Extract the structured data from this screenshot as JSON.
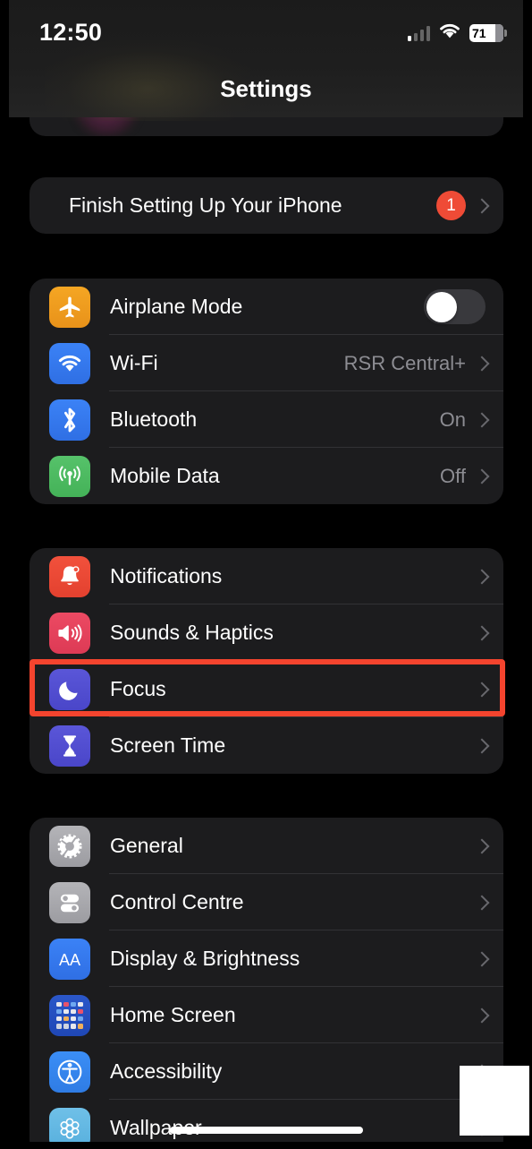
{
  "status_bar": {
    "time": "12:50",
    "signal_icon": "cellular-signal-icon",
    "wifi_icon": "wifi-icon",
    "battery_level": "71",
    "battery_icon": "battery-icon"
  },
  "nav": {
    "title": "Settings"
  },
  "colors": {
    "background": "#000000",
    "card": "#1c1c1e",
    "separator": "#323235",
    "label": "#ffffff",
    "value": "#8d8d93",
    "chevron": "#68686d",
    "badge_red": "#ef4b36",
    "highlight_red": "#f4442e",
    "toggle_track_off": "#39393d",
    "toggle_knob": "#ffffff"
  },
  "highlight": {
    "target_row": "Focus",
    "color": "#f4442e"
  },
  "groups": [
    {
      "name": "setup-group",
      "rows": [
        {
          "id": "finish-setting-up",
          "label": "Finish Setting Up Your iPhone",
          "badge": "1",
          "icon": null,
          "accessory": "chevron"
        }
      ]
    },
    {
      "name": "connectivity-group",
      "rows": [
        {
          "id": "airplane-mode",
          "label": "Airplane Mode",
          "icon": "airplane-icon",
          "accessory": "toggle",
          "toggle_state": "off"
        },
        {
          "id": "wifi",
          "label": "Wi-Fi",
          "icon": "wifi-icon",
          "value": "RSR Central+",
          "accessory": "chevron"
        },
        {
          "id": "bluetooth",
          "label": "Bluetooth",
          "icon": "bluetooth-icon",
          "value": "On",
          "accessory": "chevron"
        },
        {
          "id": "mobile-data",
          "label": "Mobile Data",
          "icon": "cellular-icon",
          "value": "Off",
          "accessory": "chevron"
        }
      ]
    },
    {
      "name": "notifications-group",
      "rows": [
        {
          "id": "notifications",
          "label": "Notifications",
          "icon": "bell-icon",
          "accessory": "chevron"
        },
        {
          "id": "sounds-haptics",
          "label": "Sounds & Haptics",
          "icon": "speaker-icon",
          "accessory": "chevron"
        },
        {
          "id": "focus",
          "label": "Focus",
          "icon": "moon-icon",
          "accessory": "chevron",
          "highlighted": true
        },
        {
          "id": "screen-time",
          "label": "Screen Time",
          "icon": "hourglass-icon",
          "accessory": "chevron"
        }
      ]
    },
    {
      "name": "general-group",
      "rows": [
        {
          "id": "general",
          "label": "General",
          "icon": "gear-icon",
          "accessory": "chevron"
        },
        {
          "id": "control-centre",
          "label": "Control Centre",
          "icon": "toggles-icon",
          "accessory": "chevron"
        },
        {
          "id": "display-brightness",
          "label": "Display & Brightness",
          "icon": "aa-icon",
          "accessory": "chevron"
        },
        {
          "id": "home-screen",
          "label": "Home Screen",
          "icon": "app-grid-icon",
          "accessory": "chevron"
        },
        {
          "id": "accessibility",
          "label": "Accessibility",
          "icon": "accessibility-icon",
          "accessory": "chevron"
        },
        {
          "id": "wallpaper",
          "label": "Wallpaper",
          "icon": "flower-icon",
          "accessory": "chevron"
        }
      ]
    }
  ]
}
